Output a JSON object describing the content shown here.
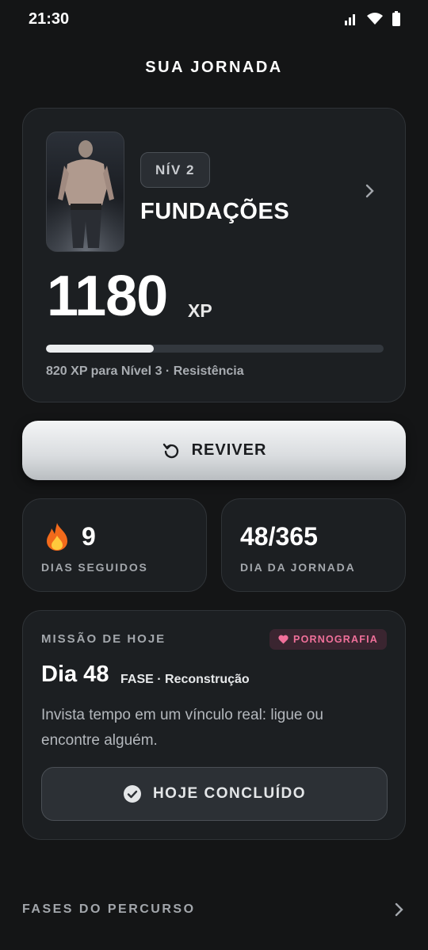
{
  "status_bar": {
    "time": "21:30"
  },
  "page": {
    "title": "SUA JORNADA"
  },
  "level": {
    "badge": "NÍV 2",
    "name": "FUNDAÇÕES",
    "xp": "1180",
    "xp_unit": "XP",
    "progress_fraction": 0.32,
    "caption": "820 XP para Nível 3 · Resistência"
  },
  "revive_button": {
    "label": "REVIVER"
  },
  "stats": {
    "streak": {
      "value": "9",
      "label": "DIAS SEGUIDOS"
    },
    "journey": {
      "value": "48/365",
      "label": "DIA DA JORNADA"
    }
  },
  "mission": {
    "heading": "MISSÃO DE HOJE",
    "tag": "PORNOGRAFIA",
    "day": "Dia 48",
    "phase": "FASE · Reconstrução",
    "text": "Invista tempo em um vínculo real: ligue ou encontre alguém.",
    "done_label": "HOJE CONCLUÍDO"
  },
  "phases": {
    "label": "FASES DO PERCURSO"
  },
  "colors": {
    "accent_tag": "#f0709a",
    "background": "#141516",
    "card": "#1c1f22"
  },
  "icons": {
    "signal": "signal-icon",
    "wifi": "wifi-icon",
    "battery": "battery-icon",
    "chevron": "chevron-right-icon",
    "revive": "revive-icon",
    "fire": "fire-icon",
    "heart": "heart-icon",
    "check": "check-circle-icon"
  }
}
